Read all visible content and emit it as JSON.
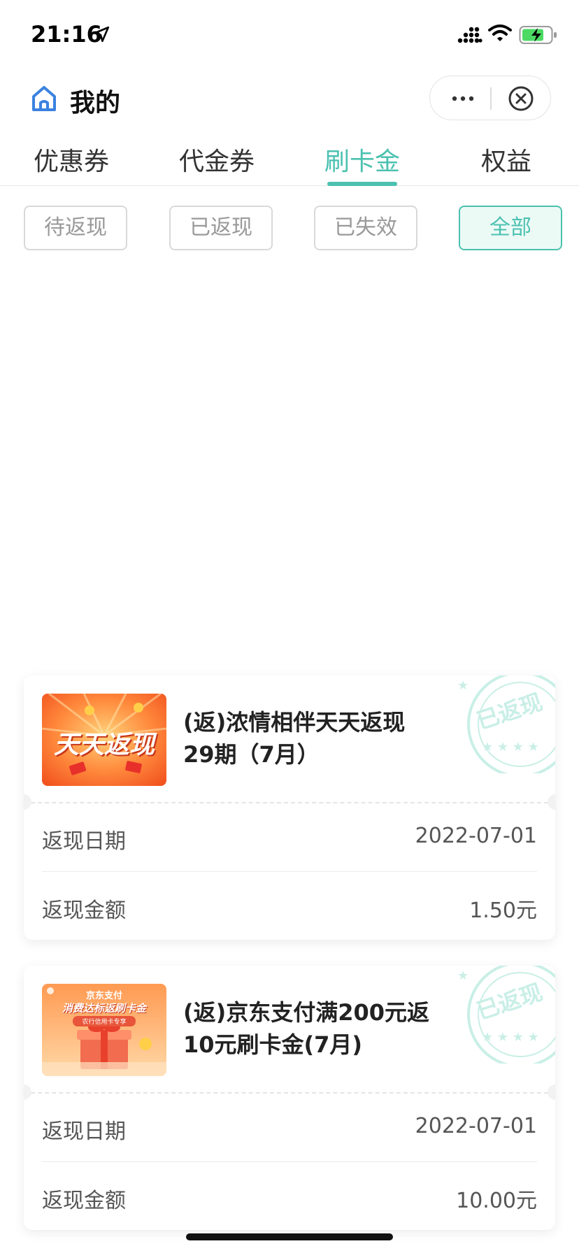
{
  "status_bar": {
    "time": "21:16",
    "icons": [
      "location-arrow-icon",
      "signal-icon",
      "wifi-icon",
      "battery-charging-icon"
    ]
  },
  "header": {
    "title": "我的",
    "home_icon": "home-icon",
    "more_icon": "more-icon",
    "close_icon": "close-circle-icon"
  },
  "tabs": [
    {
      "label": "优惠券",
      "active": false
    },
    {
      "label": "代金券",
      "active": false
    },
    {
      "label": "刷卡金",
      "active": true
    },
    {
      "label": "权益",
      "active": false
    }
  ],
  "filters": [
    {
      "label": "待返现",
      "active": false
    },
    {
      "label": "已返现",
      "active": false
    },
    {
      "label": "已失效",
      "active": false
    },
    {
      "label": "全部",
      "active": true
    }
  ],
  "records": [
    {
      "title": "(返)浓情相伴天天返现29期（7月）",
      "thumb_text": "天天返现",
      "stamp": "已返现",
      "date_label": "返现日期",
      "date": "2022-07-01",
      "amount_label": "返现金额",
      "amount": "1.50元"
    },
    {
      "title": "(返)京东支付满200元返10元刷卡金(7月)",
      "thumb_text": "消费达标返刷卡金",
      "thumb_subtitle": "京东支付",
      "thumb_footer": "农行信用卡专享",
      "stamp": "已返现",
      "date_label": "返现日期",
      "date": "2022-07-01",
      "amount_label": "返现金额",
      "amount": "10.00元"
    }
  ],
  "colors": {
    "accent": "#4cc1b0",
    "chip_active_bg": "#ecfaf6",
    "text_primary": "#222222",
    "text_muted": "#999999"
  }
}
